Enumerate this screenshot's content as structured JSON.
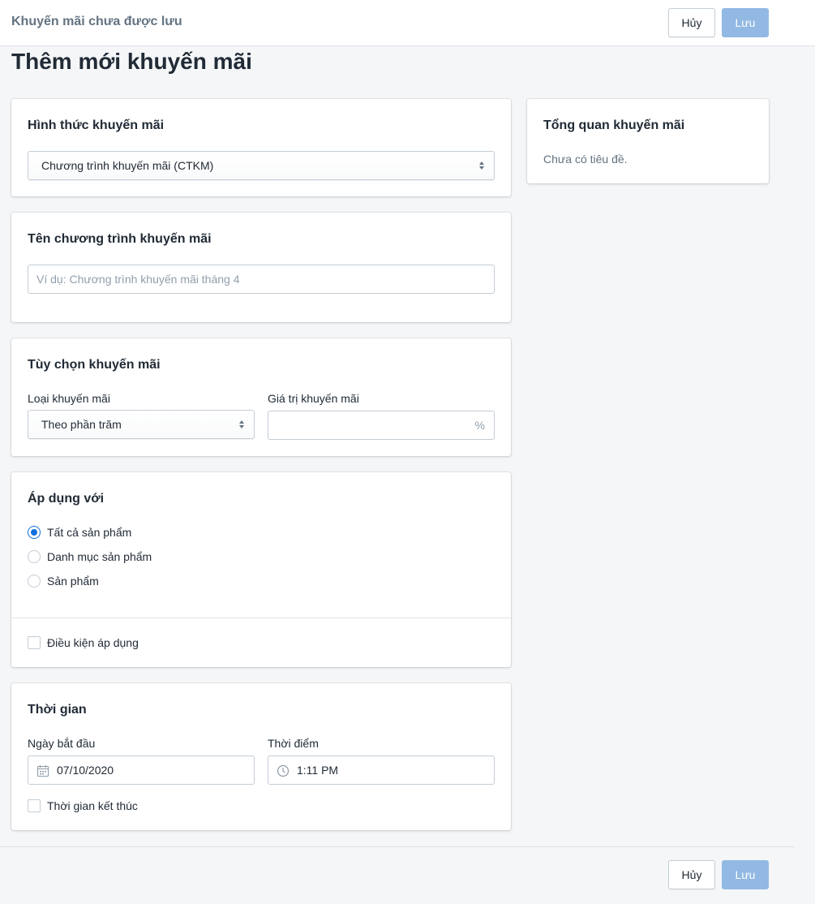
{
  "topbar": {
    "title": "Khuyến mãi chưa được lưu",
    "cancel_label": "Hủy",
    "save_label": "Lưu"
  },
  "page": {
    "title": "Thêm mới khuyến mãi"
  },
  "promo_type": {
    "heading": "Hình thức khuyến mãi",
    "selected": "Chương trình khuyến mãi (CTKM)"
  },
  "promo_name": {
    "heading": "Tên chương trình khuyến mãi",
    "placeholder": "Ví dụ: Chương trình khuyến mãi tháng 4",
    "value": ""
  },
  "promo_options": {
    "heading": "Tùy chọn khuyến mãi",
    "type_label": "Loại khuyến mãi",
    "type_selected": "Theo phần trăm",
    "value_label": "Giá trị khuyến mãi",
    "value": "",
    "value_suffix": "%"
  },
  "apply_to": {
    "heading": "Áp dụng với",
    "options": [
      {
        "label": "Tất cả sản phẩm",
        "checked": true
      },
      {
        "label": "Danh mục sản phẩm",
        "checked": false
      },
      {
        "label": "Sản phẩm",
        "checked": false
      }
    ],
    "condition_label": "Điều kiện áp dụng",
    "condition_checked": false
  },
  "schedule": {
    "heading": "Thời gian",
    "start_date_label": "Ngày bắt đầu",
    "start_date": "07/10/2020",
    "start_time_label": "Thời điểm",
    "start_time": "1:11 PM",
    "end_time_label": "Thời gian kết thúc",
    "end_time_checked": false
  },
  "summary": {
    "heading": "Tổng quan khuyến mãi",
    "text": "Chưa có tiêu đề."
  },
  "footer": {
    "cancel_label": "Hủy",
    "save_label": "Lưu"
  },
  "colors": {
    "primary": "#0f6fdb",
    "save_disabled": "#92b9e3",
    "background": "#f4f6f8"
  }
}
